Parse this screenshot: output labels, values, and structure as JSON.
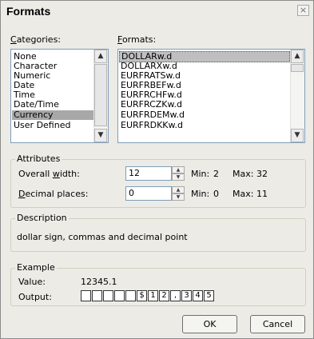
{
  "window": {
    "title": "Formats",
    "close_glyph": "×"
  },
  "categories": {
    "label_key": "C",
    "label_rest": "ategories:",
    "items": [
      "None",
      "Character",
      "Numeric",
      "Date",
      "Time",
      "Date/Time",
      "Currency",
      "User Defined"
    ],
    "selected": "Currency"
  },
  "formats": {
    "label_key": "F",
    "label_rest": "ormats:",
    "items": [
      "DOLLARw.d",
      "DOLLARXw.d",
      "EURFRATSw.d",
      "EURFRBEFw.d",
      "EURFRCHFw.d",
      "EURFRCZKw.d",
      "EURFRDEMw.d",
      "EURFRDKKw.d"
    ],
    "selected": "DOLLARw.d"
  },
  "attributes": {
    "legend": "Attributes",
    "overall_width": {
      "label_pre": "Overall ",
      "label_key": "w",
      "label_post": "idth:",
      "value": "12",
      "min_label": "Min:",
      "min": "2",
      "max_label": "Max:",
      "max": "32"
    },
    "decimal_places": {
      "label_key": "D",
      "label_post": "ecimal places:",
      "value": "0",
      "min_label": "Min:",
      "min": "0",
      "max_label": "Max:",
      "max": "11"
    }
  },
  "description": {
    "legend": "Description",
    "text": "dollar sign, commas and decimal point"
  },
  "example": {
    "legend": "Example",
    "value_label": "Value:",
    "value": "12345.1",
    "output_label": "Output:",
    "output_cells": [
      "",
      "",
      "",
      "",
      "",
      "$",
      "1",
      "2",
      ",",
      "3",
      "4",
      "5"
    ]
  },
  "buttons": {
    "ok": "OK",
    "cancel": "Cancel"
  },
  "colors": {
    "dialog_bg": "#ecebe6",
    "selection": "#a8a8a8",
    "border": "#7f9db9"
  }
}
